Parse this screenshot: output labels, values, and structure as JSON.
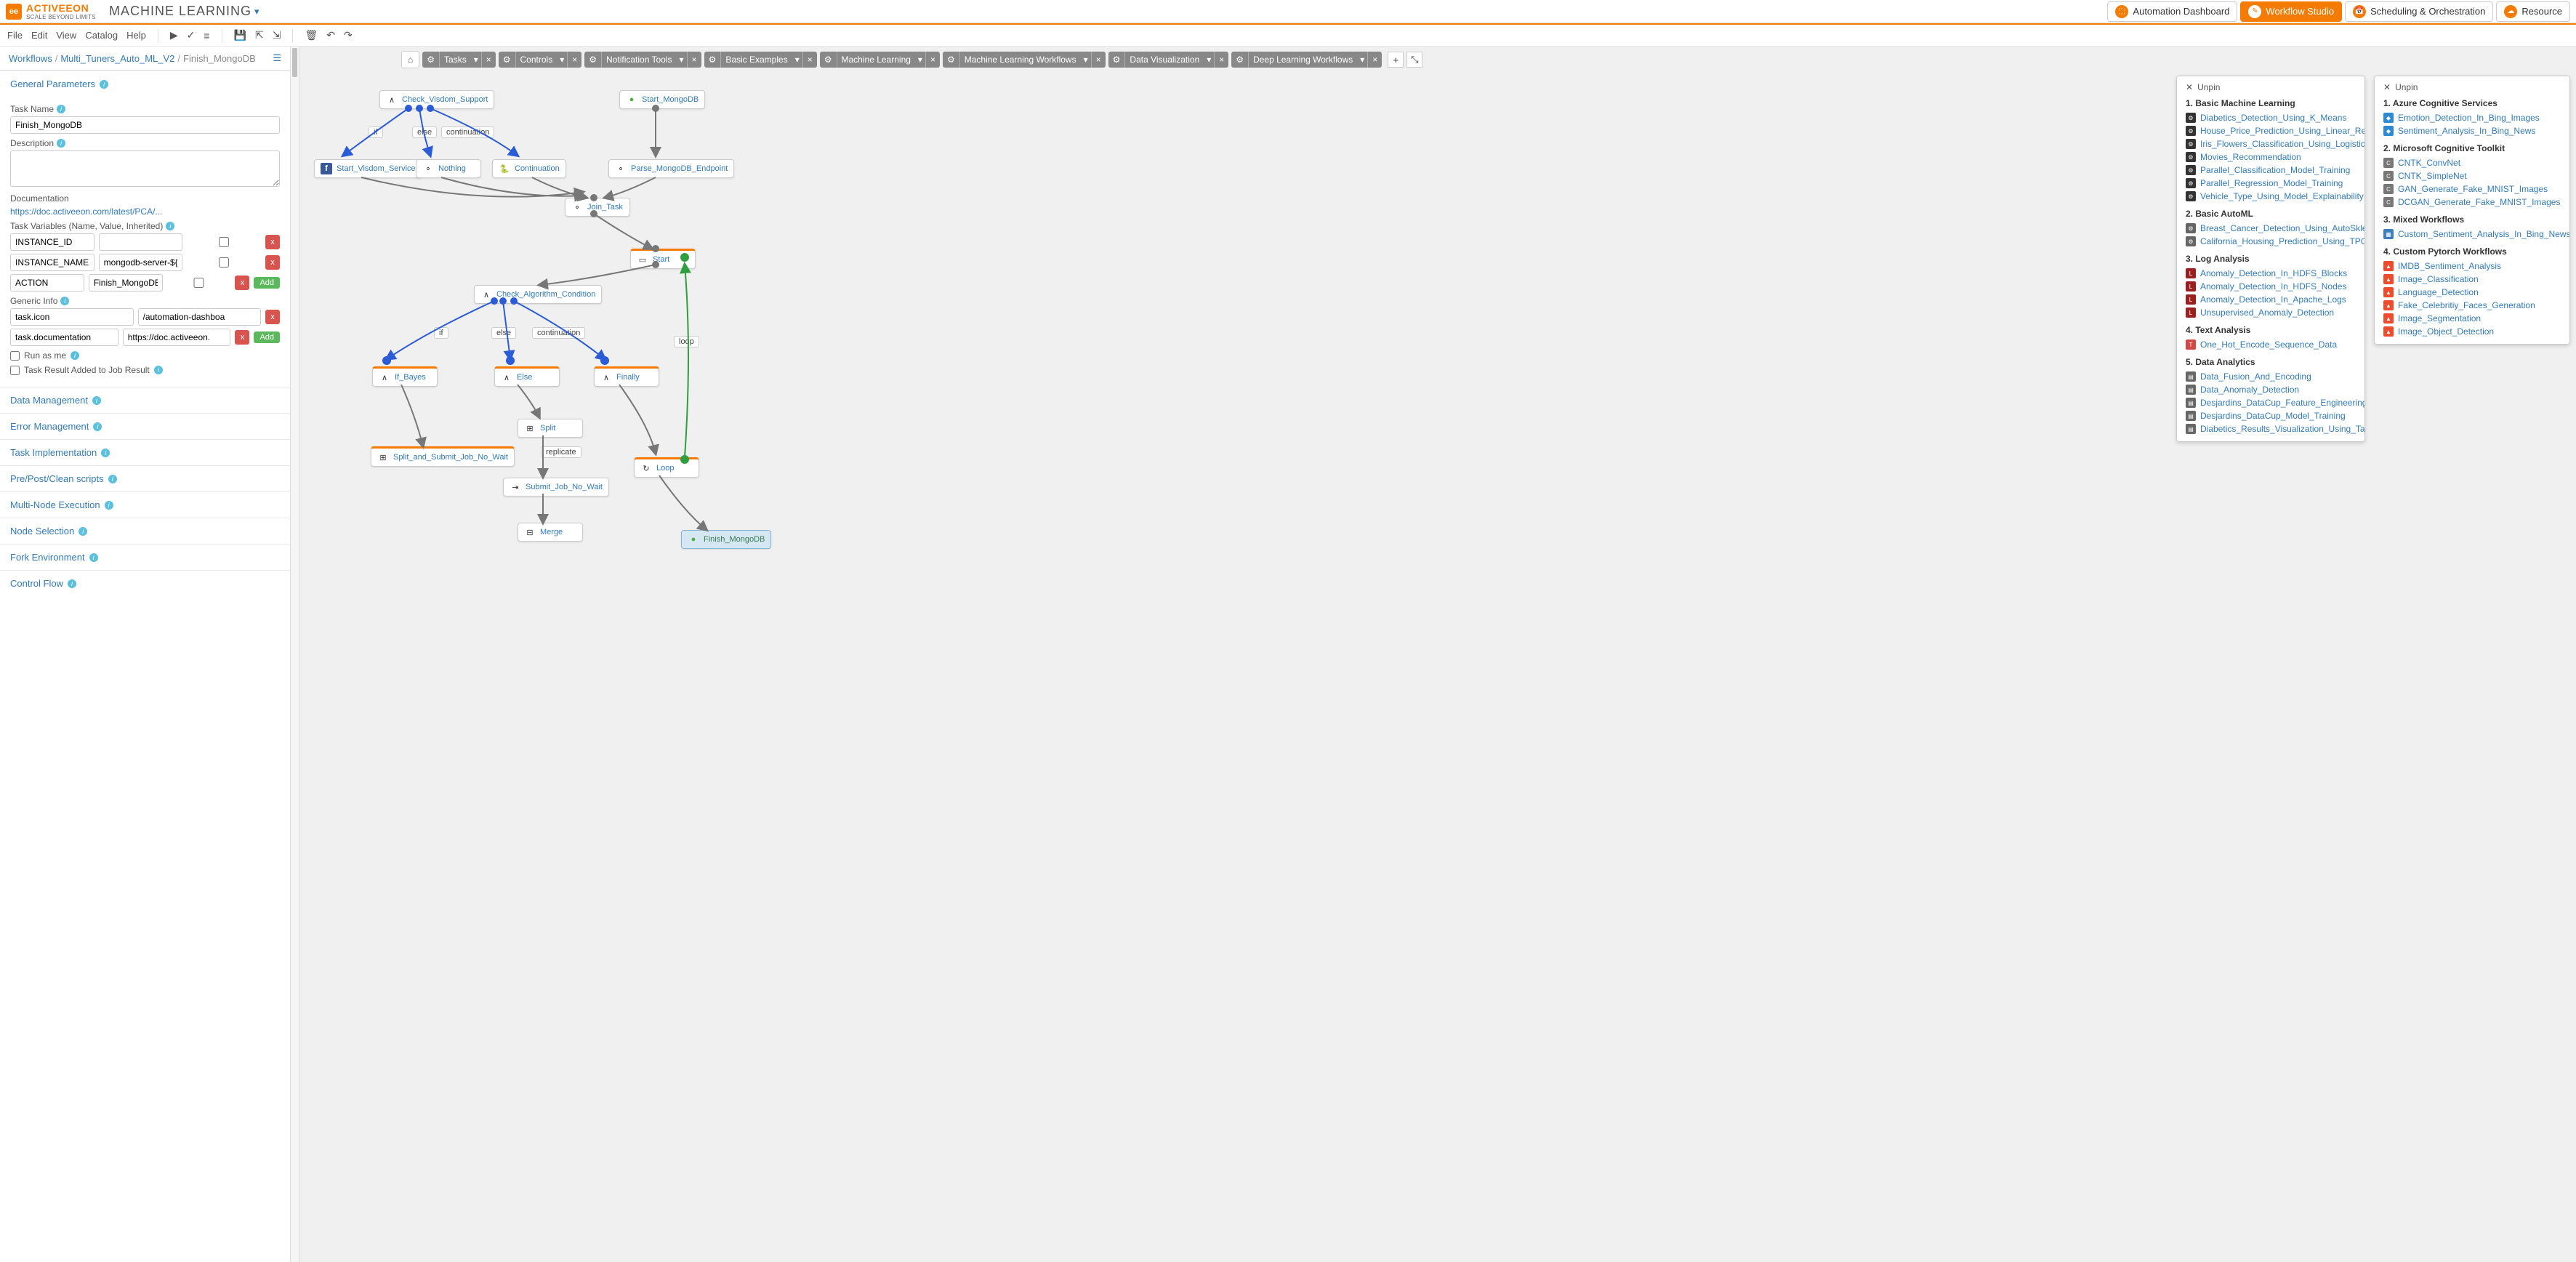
{
  "app": {
    "name": "ACTIVEEON",
    "tagline": "SCALE BEYOND LIMITS",
    "title": "MACHINE LEARNING"
  },
  "topnav": {
    "dashboard": "Automation Dashboard",
    "studio": "Workflow Studio",
    "sched": "Scheduling & Orchestration",
    "resource": "Resource"
  },
  "menu": {
    "file": "File",
    "edit": "Edit",
    "view": "View",
    "catalog": "Catalog",
    "help": "Help"
  },
  "breadcrumb": {
    "a": "Workflows",
    "b": "Multi_Tuners_Auto_ML_V2",
    "c": "Finish_MongoDB"
  },
  "sections": {
    "general": "General Parameters",
    "data": "Data Management",
    "error": "Error Management",
    "impl": "Task Implementation",
    "scripts": "Pre/Post/Clean scripts",
    "multi": "Multi-Node Execution",
    "nodesel": "Node Selection",
    "fork": "Fork Environment",
    "control": "Control Flow"
  },
  "labels": {
    "taskName": "Task Name",
    "description": "Description",
    "documentation": "Documentation",
    "taskVars": "Task Variables (Name, Value, Inherited)",
    "genericInfo": "Generic Info",
    "runas": "Run as me",
    "taskresult": "Task Result Added to Job Result",
    "add": "Add"
  },
  "form": {
    "taskName": "Finish_MongoDB",
    "docLink": "https://doc.activeeon.com/latest/PCA/...",
    "vars": [
      {
        "name": "INSTANCE_ID",
        "value": ""
      },
      {
        "name": "INSTANCE_NAME",
        "value": "mongodb-server-${PA"
      },
      {
        "name": "ACTION",
        "value": "Finish_MongoDB"
      }
    ],
    "generic": [
      {
        "name": "task.icon",
        "value": "/automation-dashboa"
      },
      {
        "name": "task.documentation",
        "value": "https://doc.activeeon."
      }
    ]
  },
  "tabs": [
    "Tasks",
    "Controls",
    "Notification Tools",
    "Basic Examples",
    "Machine Learning",
    "Machine Learning Workflows",
    "Data Visualization",
    "Deep Learning Workflows"
  ],
  "nodes": {
    "check_visdom": "Check_Visdom_Support",
    "start_mongo": "Start_MongoDB",
    "start_visdom": "Start_Visdom_Service",
    "nothing": "Nothing",
    "continuation": "Continuation",
    "parse": "Parse_MongoDB_Endpoint",
    "join": "Join_Task",
    "start": "Start",
    "check_algo": "Check_Algorithm_Condition",
    "if_bayes": "If_Bayes",
    "else": "Else",
    "finally": "Finally",
    "split": "Split",
    "split_submit": "Split_and_Submit_Job_No_Wait",
    "submit": "Submit_Job_No_Wait",
    "merge": "Merge",
    "loop": "Loop",
    "finish": "Finish_MongoDB"
  },
  "flowlabels": {
    "if": "if",
    "else": "else",
    "continuation": "continuation",
    "replicate": "replicate",
    "loop": "loop"
  },
  "palette1": {
    "unpin": "Unpin",
    "h1": "1. Basic Machine Learning",
    "i1": [
      "Diabetics_Detection_Using_K_Means",
      "House_Price_Prediction_Using_Linear_Regression",
      "Iris_Flowers_Classification_Using_Logistic_Regression",
      "Movies_Recommendation",
      "Parallel_Classification_Model_Training",
      "Parallel_Regression_Model_Training",
      "Vehicle_Type_Using_Model_Explainability"
    ],
    "h2": "2. Basic AutoML",
    "i2": [
      "Breast_Cancer_Detection_Using_AutoSklearn_Classifier",
      "California_Housing_Prediction_Using_TPOT_Regressor"
    ],
    "h3": "3. Log Analysis",
    "i3": [
      "Anomaly_Detection_In_HDFS_Blocks",
      "Anomaly_Detection_In_HDFS_Nodes",
      "Anomaly_Detection_In_Apache_Logs",
      "Unsupervised_Anomaly_Detection"
    ],
    "h4": "4. Text Analysis",
    "i4": [
      "One_Hot_Encode_Sequence_Data"
    ],
    "h5": "5. Data Analytics",
    "i5": [
      "Data_Fusion_And_Encoding",
      "Data_Anomaly_Detection",
      "Desjardins_DataCup_Feature_Engineering",
      "Desjardins_DataCup_Model_Training",
      "Diabetics_Results_Visualization_Using_Tableau"
    ]
  },
  "palette2": {
    "unpin": "Unpin",
    "h1": "1. Azure Cognitive Services",
    "i1": [
      "Emotion_Detection_In_Bing_Images",
      "Sentiment_Analysis_In_Bing_News"
    ],
    "h2": "2. Microsoft Cognitive Toolkit",
    "i2": [
      "CNTK_ConvNet",
      "CNTK_SimpleNet",
      "GAN_Generate_Fake_MNIST_Images",
      "DCGAN_Generate_Fake_MNIST_Images"
    ],
    "h3": "3. Mixed Workflows",
    "i3": [
      "Custom_Sentiment_Analysis_In_Bing_News"
    ],
    "h4": "4. Custom Pytorch Workflows",
    "i4": [
      "IMDB_Sentiment_Analysis",
      "Image_Classification",
      "Language_Detection",
      "Fake_Celebritiy_Faces_Generation",
      "Image_Segmentation",
      "Image_Object_Detection"
    ]
  }
}
